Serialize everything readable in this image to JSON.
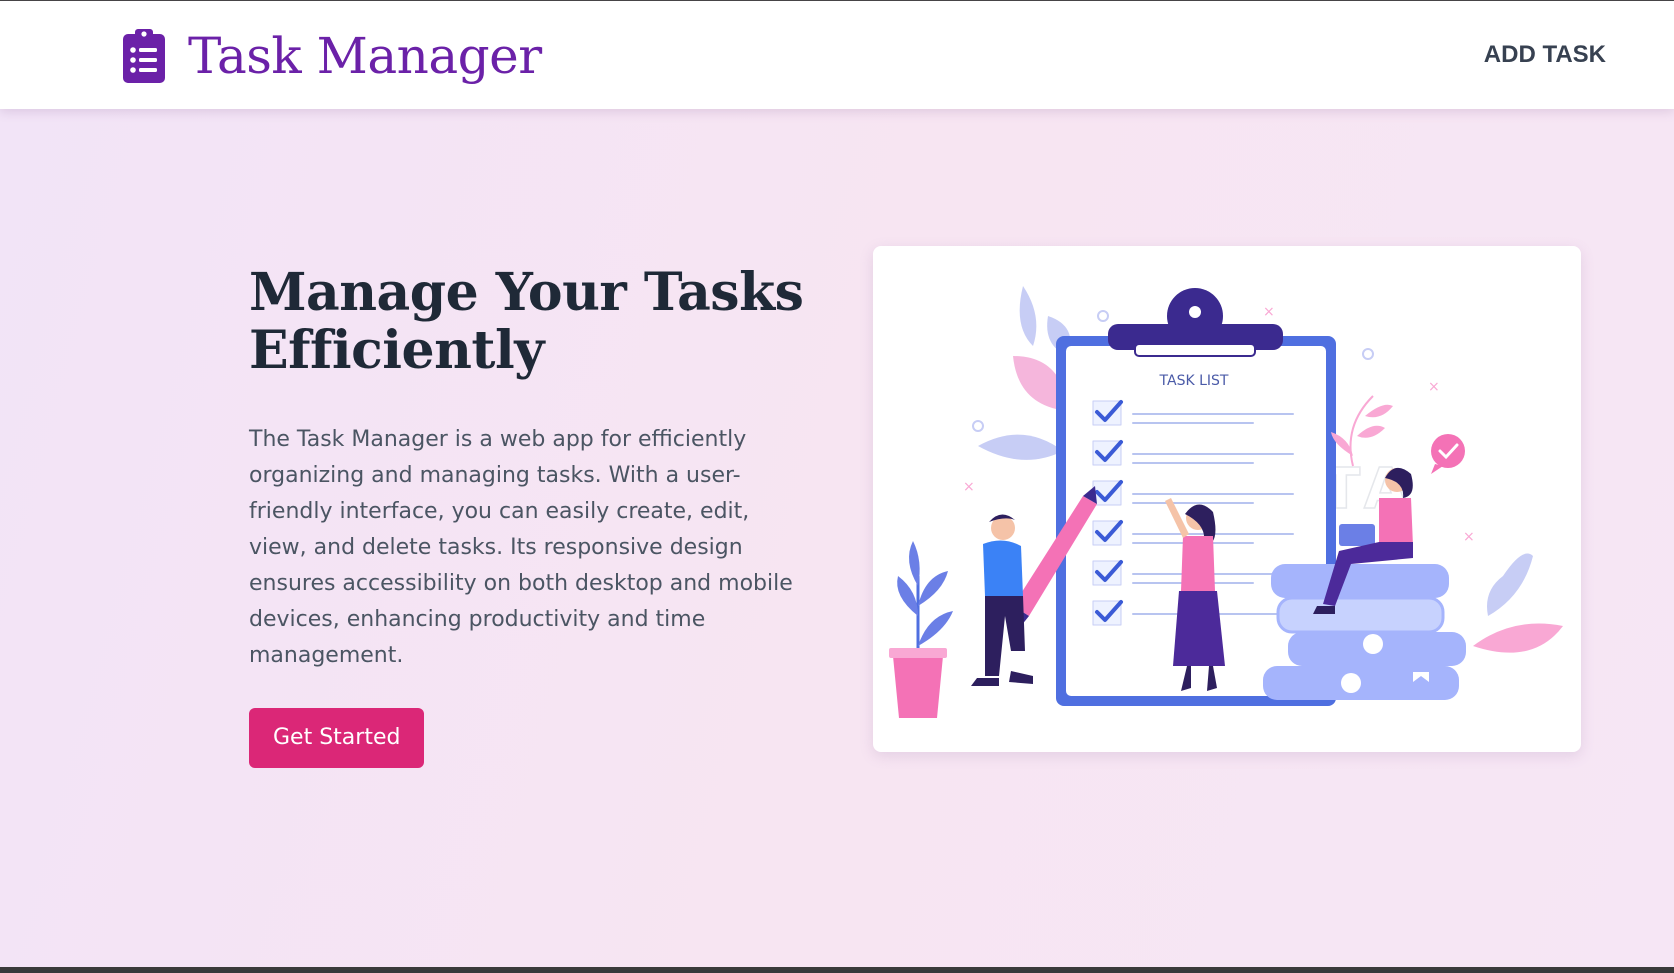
{
  "header": {
    "brand_icon": "clipboard-list-icon",
    "brand_name": "Task Manager",
    "nav_add_task": "ADD TASK"
  },
  "hero": {
    "title": "Manage Your Tasks Efficiently",
    "description": "The Task Manager is a web app for efficiently organizing and managing tasks. With a user-friendly interface, you can easily create, edit, view, and delete tasks. Its responsive design ensures accessibility on both desktop and mobile devices, enhancing productivity and time management.",
    "cta_label": "Get Started"
  },
  "illustration": {
    "clipboard_heading": "TASK LIST",
    "watermark": "PIXTA"
  },
  "colors": {
    "brand": "#6b21a8",
    "accent": "#db2777",
    "heading": "#1f2937",
    "body_text": "#4b5563",
    "background": "#f4e6f6"
  }
}
